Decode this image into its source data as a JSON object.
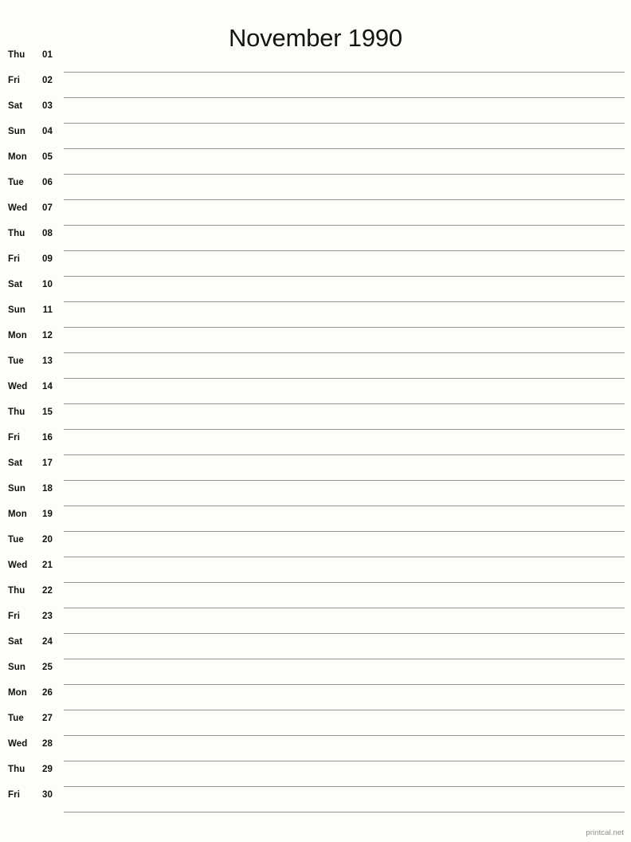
{
  "header": {
    "title": "November 1990"
  },
  "colors": {
    "background": "#fdfdfa",
    "text": "#111111",
    "rule_line": "#9a9a96",
    "footer_text": "#8c8c8c"
  },
  "calendar": {
    "month": "November",
    "year": "1990",
    "columns": [
      "weekday",
      "day",
      "notes"
    ],
    "rows": [
      {
        "weekday": "Thu",
        "day": "01"
      },
      {
        "weekday": "Fri",
        "day": "02"
      },
      {
        "weekday": "Sat",
        "day": "03"
      },
      {
        "weekday": "Sun",
        "day": "04"
      },
      {
        "weekday": "Mon",
        "day": "05"
      },
      {
        "weekday": "Tue",
        "day": "06"
      },
      {
        "weekday": "Wed",
        "day": "07"
      },
      {
        "weekday": "Thu",
        "day": "08"
      },
      {
        "weekday": "Fri",
        "day": "09"
      },
      {
        "weekday": "Sat",
        "day": "10"
      },
      {
        "weekday": "Sun",
        "day": "11"
      },
      {
        "weekday": "Mon",
        "day": "12"
      },
      {
        "weekday": "Tue",
        "day": "13"
      },
      {
        "weekday": "Wed",
        "day": "14"
      },
      {
        "weekday": "Thu",
        "day": "15"
      },
      {
        "weekday": "Fri",
        "day": "16"
      },
      {
        "weekday": "Sat",
        "day": "17"
      },
      {
        "weekday": "Sun",
        "day": "18"
      },
      {
        "weekday": "Mon",
        "day": "19"
      },
      {
        "weekday": "Tue",
        "day": "20"
      },
      {
        "weekday": "Wed",
        "day": "21"
      },
      {
        "weekday": "Thu",
        "day": "22"
      },
      {
        "weekday": "Fri",
        "day": "23"
      },
      {
        "weekday": "Sat",
        "day": "24"
      },
      {
        "weekday": "Sun",
        "day": "25"
      },
      {
        "weekday": "Mon",
        "day": "26"
      },
      {
        "weekday": "Tue",
        "day": "27"
      },
      {
        "weekday": "Wed",
        "day": "28"
      },
      {
        "weekday": "Thu",
        "day": "29"
      },
      {
        "weekday": "Fri",
        "day": "30"
      }
    ]
  },
  "footer": {
    "attribution": "printcal.net"
  }
}
